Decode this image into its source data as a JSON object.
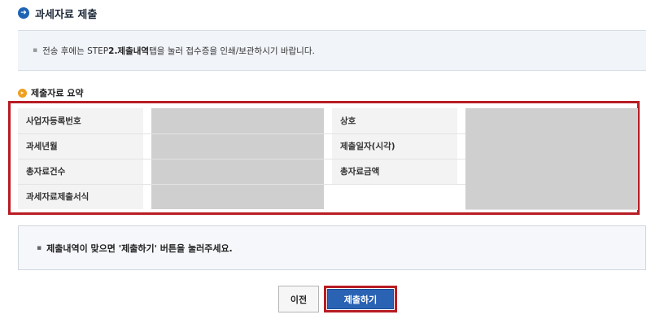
{
  "header": {
    "title": "과세자료 제출",
    "icon": "arrow-right-circle-icon",
    "icon_color": "#1e64b4"
  },
  "info": {
    "prefix": "전송 후에는 STEP ",
    "bold": "2.제출내역",
    "suffix": " 탭을 눌러 접수증을 인쇄/보관하시기 바랍니다."
  },
  "summary": {
    "title": "제출자료 요약",
    "icon": "arrow-right-circle-icon",
    "icon_color": "#f0a020",
    "labels": {
      "business_number": "사업자등록번호",
      "trade_name": "상호",
      "tax_year_month": "과세년월",
      "submission_date": "제출일자(시각)",
      "total_count": "총자료건수",
      "total_amount": "총자료금액",
      "submission_format": "과세자료제출서식"
    }
  },
  "notice": {
    "text": "제출내역이 맞으면 '제출하기' 버튼을 눌러주세요."
  },
  "buttons": {
    "prev": "이전",
    "submit": "제출하기"
  },
  "colors": {
    "highlight_border": "#b81c24",
    "primary_button": "#2a62b4",
    "masked_cell": "#cfcfcf"
  }
}
